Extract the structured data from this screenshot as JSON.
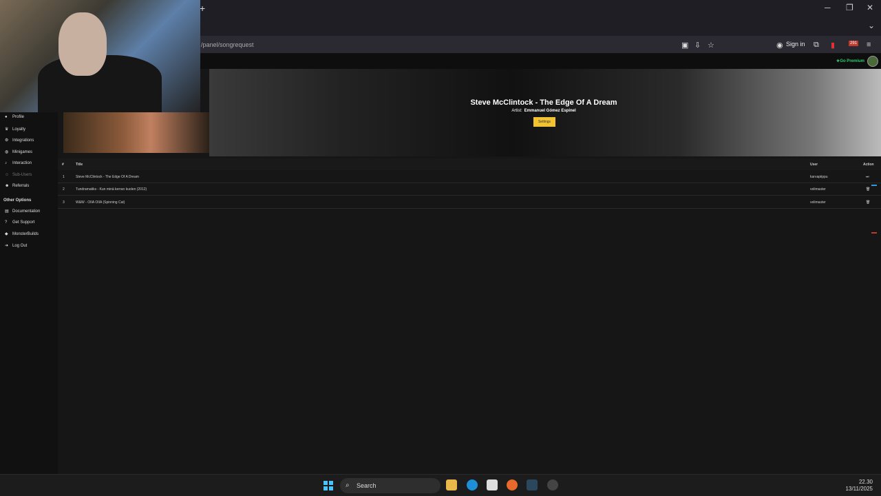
{
  "browser": {
    "new_tab": "+",
    "minimize": "─",
    "restore": "❐",
    "close": "✕",
    "chevron": "⌄",
    "url": "/panel/songrequest",
    "sign_in": "Sign in",
    "badge_count": "291"
  },
  "site": {
    "go_premium": "Go Premium"
  },
  "now_playing": {
    "title": "Steve McClintock - The Edge Of A Dream",
    "artist_label": "Artist:",
    "artist_name": "Emmanuel Gómez Espinel",
    "settings_button": "Settings"
  },
  "sidebar": {
    "items": [
      {
        "label": "Profile",
        "icon": "user-icon"
      },
      {
        "label": "Loyalty",
        "icon": "trophy-icon"
      },
      {
        "label": "Integrations",
        "icon": "plug-icon"
      },
      {
        "label": "Minigames",
        "icon": "gamepad-icon"
      },
      {
        "label": "Interaction",
        "icon": "music-icon"
      },
      {
        "label": "Sub-Users",
        "icon": "users-icon"
      },
      {
        "label": "Referrals",
        "icon": "group-icon"
      }
    ],
    "other_heading": "Other Options",
    "other_items": [
      {
        "label": "Documentation",
        "icon": "book-icon"
      },
      {
        "label": "Get Support",
        "icon": "help-icon"
      },
      {
        "label": "MonsterBuilds",
        "icon": "monster-icon"
      },
      {
        "label": "Log Out",
        "icon": "logout-icon"
      }
    ]
  },
  "queue": {
    "headers": {
      "num": "#",
      "title": "Title",
      "user": "User",
      "action": "Action"
    },
    "rows": [
      {
        "num": "1",
        "title": "Steve McClintock - The Edge Of A Dream",
        "user": "karvapiippu",
        "action": "⏭"
      },
      {
        "num": "2",
        "title": "Tundramatiks - Kun minä kerran kuolen (2012)",
        "user": "velimaster",
        "action": "🗑"
      },
      {
        "num": "3",
        "title": "W&W - OIIA OIIA (Spinning Cat)",
        "user": "velimaster",
        "action": "🗑"
      }
    ]
  },
  "taskbar": {
    "search_placeholder": "Search",
    "time": "22.30",
    "date": "13/11/2025"
  },
  "colors": {
    "accent_yellow": "#f1c232",
    "premium_green": "#2ecc71"
  }
}
